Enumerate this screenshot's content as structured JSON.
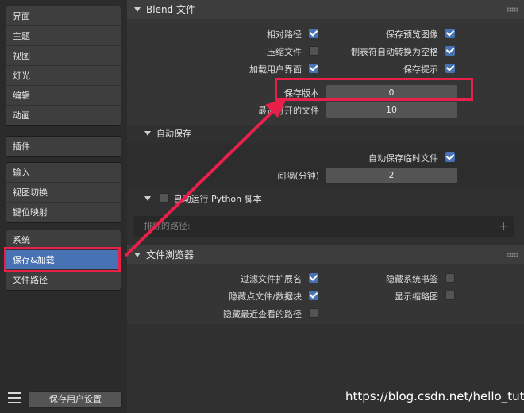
{
  "sidebar": {
    "groups": [
      [
        "界面",
        "主题",
        "视图",
        "灯光",
        "编辑",
        "动画"
      ],
      [
        "插件"
      ],
      [
        "输入",
        "视图切换",
        "键位映射"
      ],
      [
        "系统",
        "保存&加载",
        "文件路径"
      ]
    ],
    "active_item": "保存&加载",
    "save_button": "保存用户设置"
  },
  "blend": {
    "title": "Blend 文件",
    "relative_paths": "相对路径",
    "save_preview": "保存预览图像",
    "compress": "压缩文件",
    "tabs_to_spaces": "制表符自动转换为空格",
    "load_ui": "加载用户界面",
    "save_prompt": "保存提示",
    "save_versions_label": "保存版本",
    "save_versions_value": "0",
    "recent_files_label": "最近打开的文件",
    "recent_files_value": "10",
    "checked": {
      "relative_paths": true,
      "save_preview": true,
      "compress": false,
      "tabs_to_spaces": true,
      "load_ui": true,
      "save_prompt": true
    }
  },
  "autosave": {
    "title": "自动保存",
    "temp_label": "自动保存临时文件",
    "temp_checked": true,
    "interval_label": "间隔(分钟)",
    "interval_value": "2"
  },
  "python": {
    "title": "自动运行 Python 脚本",
    "checked": false,
    "excluded_placeholder": "排除的路径:"
  },
  "browser": {
    "title": "文件浏览器",
    "filter_ext": "过滤文件扩展名",
    "hide_bookmarks": "隐藏系统书签",
    "hide_dot": "隐藏点文件/数据块",
    "show_thumbs": "显示缩略图",
    "hide_recent": "隐藏最近查看的路径",
    "checked": {
      "filter_ext": true,
      "hide_bookmarks": false,
      "hide_dot": true,
      "show_thumbs": false,
      "hide_recent": false
    }
  },
  "watermark": "https://blog.csdn.net/hello_tute",
  "colors": {
    "accent": "#4772b3",
    "annotation": "#e8204a"
  }
}
